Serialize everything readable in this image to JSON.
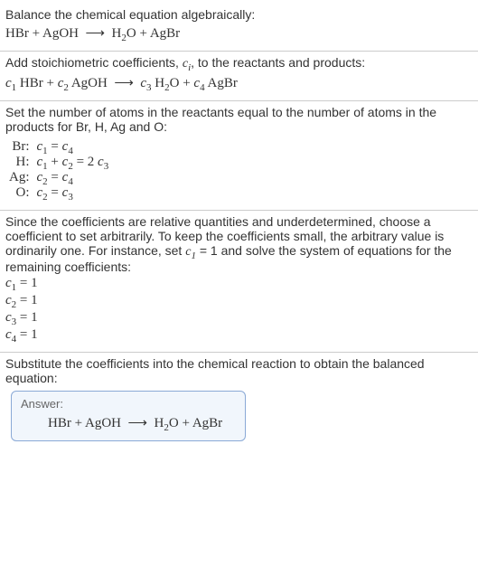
{
  "intro": {
    "line1": "Balance the chemical equation algebraically:"
  },
  "equation_plain": {
    "lhs1": "HBr",
    "lhs2": "AgOH",
    "rhs1_pre": "H",
    "rhs1_sub": "2",
    "rhs1_post": "O",
    "rhs2": "AgBr"
  },
  "stoich_intro_a": "Add stoichiometric coefficients, ",
  "stoich_intro_var": "c",
  "stoich_intro_sub": "i",
  "stoich_intro_b": ", to the reactants and products:",
  "stoich_eq": {
    "c": "c",
    "s1": "1",
    "t1": " HBr",
    "s2": "2",
    "t2": " AgOH",
    "s3": "3",
    "t3_pre": " H",
    "t3_sub": "2",
    "t3_post": "O",
    "s4": "4",
    "t4": " AgBr"
  },
  "atoms_intro": "Set the number of atoms in the reactants equal to the number of atoms in the products for Br, H, Ag and O:",
  "atoms": [
    {
      "label": "Br:",
      "lhs_a": "c",
      "lhs_as": "1",
      "lhs_eq": " = ",
      "rhs_a": "c",
      "rhs_as": "4",
      "extra": ""
    },
    {
      "label": "H:",
      "lhs_a": "c",
      "lhs_as": "1",
      "mid": " + ",
      "lhs_b": "c",
      "lhs_bs": "2",
      "lhs_eq": " = 2 ",
      "rhs_a": "c",
      "rhs_as": "3",
      "extra": ""
    },
    {
      "label": "Ag:",
      "lhs_a": "c",
      "lhs_as": "2",
      "lhs_eq": " = ",
      "rhs_a": "c",
      "rhs_as": "4",
      "extra": ""
    },
    {
      "label": "O:",
      "lhs_a": "c",
      "lhs_as": "2",
      "lhs_eq": " = ",
      "rhs_a": "c",
      "rhs_as": "3",
      "extra": ""
    }
  ],
  "choose_intro_a": "Since the coefficients are relative quantities and underdetermined, choose a coefficient to set arbitrarily. To keep the coefficients small, the arbitrary value is ordinarily one. For instance, set ",
  "choose_var": "c",
  "choose_sub": "1",
  "choose_intro_b": " = 1 and solve the system of equations for the remaining coefficients:",
  "solved": [
    {
      "v": "c",
      "s": "1",
      "eq": " = 1"
    },
    {
      "v": "c",
      "s": "2",
      "eq": " = 1"
    },
    {
      "v": "c",
      "s": "3",
      "eq": " = 1"
    },
    {
      "v": "c",
      "s": "4",
      "eq": " = 1"
    }
  ],
  "sub_intro": "Substitute the coefficients into the chemical reaction to obtain the balanced equation:",
  "answer_label": "Answer:",
  "arrow": "⟶",
  "plus": " + "
}
